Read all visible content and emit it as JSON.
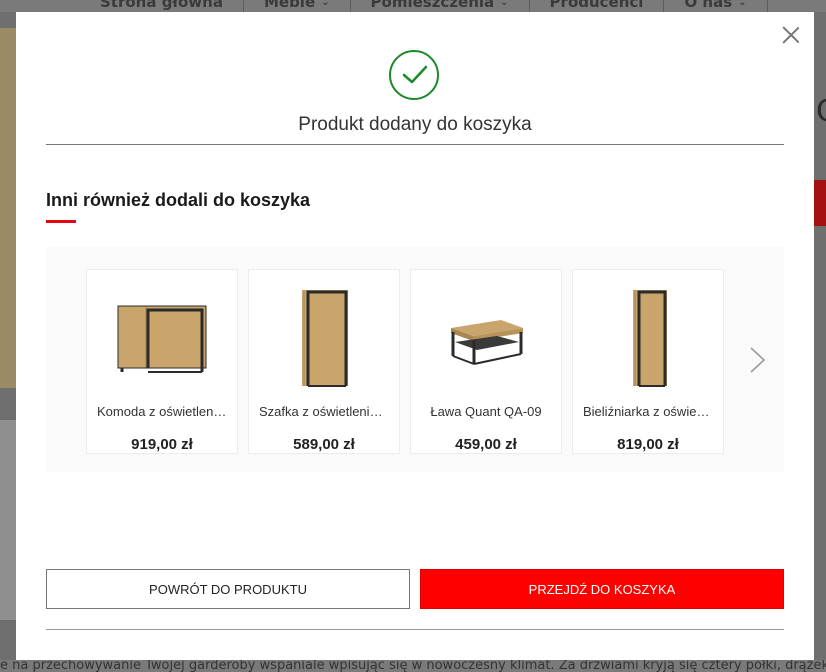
{
  "background": {
    "nav": [
      {
        "label": "Strona główna",
        "has_dropdown": false
      },
      {
        "label": "Meble",
        "has_dropdown": true
      },
      {
        "label": "Pomieszczenia",
        "has_dropdown": true
      },
      {
        "label": "Producenci",
        "has_dropdown": false
      },
      {
        "label": "O nas",
        "has_dropdown": true
      }
    ],
    "footer_text": "e na przechowywanie Twojej garderoby wspaniale wpisując się w nowoczesny klimat. Za drzwiami kryją się cztery półki, drążek na ubrani",
    "right_char": "C"
  },
  "modal": {
    "close_icon": "close-icon",
    "status_icon": "check-circle-icon",
    "title": "Produkt dodany do koszyka",
    "section_title": "Inni również dodali do koszyka",
    "products": [
      {
        "name": "Komoda z oświetleniem Quant",
        "price": "919,00 zł",
        "image_icon": "dresser-icon"
      },
      {
        "name": "Szafka z oświetleniem Quant",
        "price": "589,00 zł",
        "image_icon": "cabinet-icon"
      },
      {
        "name": "Ława Quant QA-09",
        "price": "459,00 zł",
        "image_icon": "coffee-table-icon"
      },
      {
        "name": "Bieliźniarka z oświetleniem Quant",
        "price": "819,00 zł",
        "image_icon": "tall-cabinet-icon"
      }
    ],
    "next_icon": "chevron-right-icon",
    "back_button": "POWRÓT DO PRODUKTU",
    "cart_button": "PRZEJDŹ DO KOSZYKA"
  },
  "colors": {
    "accent_red": "#ff0000",
    "underline_red": "#e30613",
    "success_green": "#1a8a2a",
    "wood": "#c9a46b",
    "frame": "#2b2b2b"
  }
}
